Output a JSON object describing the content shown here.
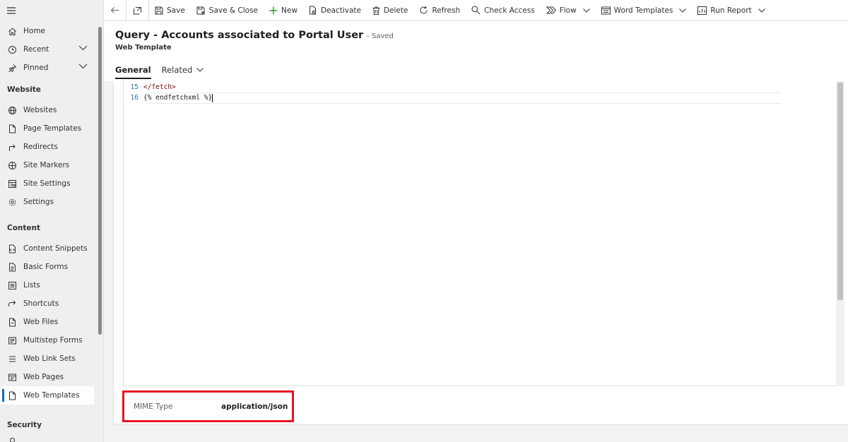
{
  "sidebar": {
    "top_items": [
      {
        "label": "Home",
        "icon": "home-icon"
      },
      {
        "label": "Recent",
        "icon": "clock-icon"
      },
      {
        "label": "Pinned",
        "icon": "pin-icon"
      }
    ],
    "sections": [
      {
        "title": "Website",
        "items": [
          {
            "label": "Websites",
            "icon": "globe-icon"
          },
          {
            "label": "Page Templates",
            "icon": "page-icon"
          },
          {
            "label": "Redirects",
            "icon": "redirect-icon"
          },
          {
            "label": "Site Markers",
            "icon": "site-marker-icon"
          },
          {
            "label": "Site Settings",
            "icon": "site-settings-icon"
          },
          {
            "label": "Settings",
            "icon": "gear-icon"
          }
        ]
      },
      {
        "title": "Content",
        "items": [
          {
            "label": "Content Snippets",
            "icon": "snippet-icon"
          },
          {
            "label": "Basic Forms",
            "icon": "form-icon"
          },
          {
            "label": "Lists",
            "icon": "list-icon"
          },
          {
            "label": "Shortcuts",
            "icon": "shortcut-icon"
          },
          {
            "label": "Web Files",
            "icon": "file-icon"
          },
          {
            "label": "Multistep Forms",
            "icon": "multistep-icon"
          },
          {
            "label": "Web Link Sets",
            "icon": "link-set-icon"
          },
          {
            "label": "Web Pages",
            "icon": "web-page-icon"
          },
          {
            "label": "Web Templates",
            "icon": "template-icon",
            "selected": true
          }
        ]
      },
      {
        "title": "Security",
        "items": []
      }
    ]
  },
  "toolbar": {
    "save": "Save",
    "save_close": "Save & Close",
    "new": "New",
    "deactivate": "Deactivate",
    "delete": "Delete",
    "refresh": "Refresh",
    "check_access": "Check Access",
    "flow": "Flow",
    "word_templates": "Word Templates",
    "run_report": "Run Report"
  },
  "header": {
    "title": "Query - Accounts associated to Portal User",
    "status": "- Saved",
    "entity_type": "Web Template",
    "tabs": [
      "General",
      "Related"
    ]
  },
  "editor": {
    "lines": [
      {
        "number": "15",
        "text": "</fetch>"
      },
      {
        "number": "16",
        "text": "{% endfetchxml %}"
      }
    ]
  },
  "mime": {
    "label": "MIME Type",
    "value": "application/json"
  },
  "colors": {
    "accent": "#0f6cbd",
    "highlight_border": "#e81123"
  }
}
